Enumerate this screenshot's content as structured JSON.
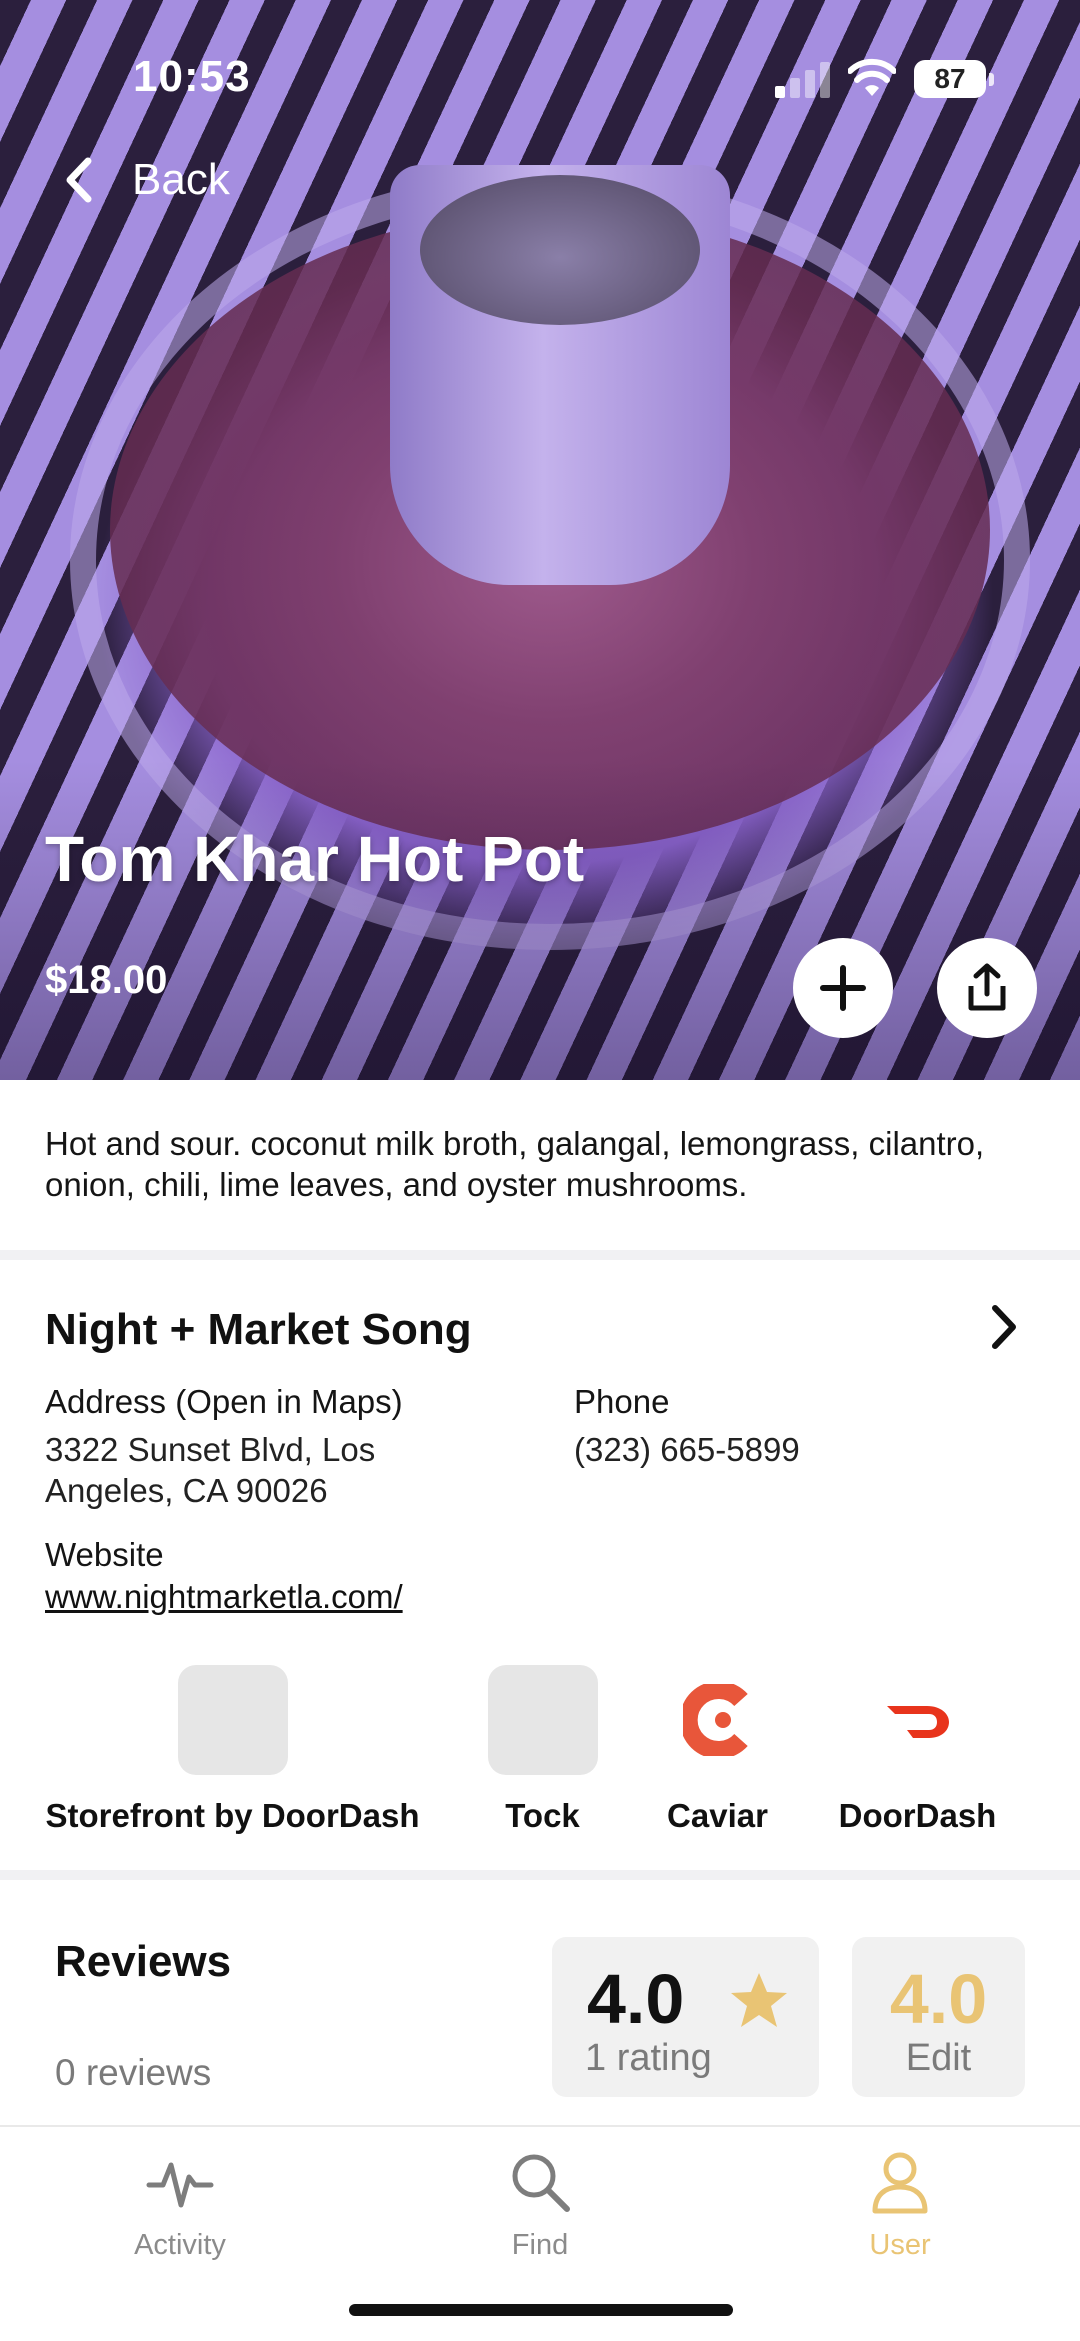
{
  "status_bar": {
    "time": "10:53",
    "battery": "87"
  },
  "nav": {
    "back_label": "Back"
  },
  "dish": {
    "name": "Tom Khar Hot Pot",
    "price": "$18.00",
    "description": "Hot and sour. coconut milk broth, galangal, lemongrass, cilantro, onion, chili, lime leaves, and oyster mushrooms."
  },
  "restaurant": {
    "name": "Night + Market Song",
    "address_label": "Address (Open in Maps)",
    "address_line1": "3322 Sunset Blvd, Los",
    "address_line2": "Angeles, CA 90026",
    "phone_label": "Phone",
    "phone": "(323) 665-5899",
    "website_label": "Website",
    "website": "www.nightmarketla.com/"
  },
  "partners": [
    {
      "name": "Storefront by DoorDash",
      "icon": "placeholder-tile"
    },
    {
      "name": "Tock",
      "icon": "placeholder-tile"
    },
    {
      "name": "Caviar",
      "icon": "caviar-logo"
    },
    {
      "name": "DoorDash",
      "icon": "doordash-logo"
    }
  ],
  "reviews": {
    "title": "Reviews",
    "count": "0 reviews",
    "rating_value": "4.0",
    "rating_sub": "1 rating",
    "user_rating": "4.0",
    "edit_label": "Edit"
  },
  "tabs": [
    {
      "label": "Activity",
      "icon": "activity-icon",
      "active": false
    },
    {
      "label": "Find",
      "icon": "search-icon",
      "active": false
    },
    {
      "label": "User",
      "icon": "user-icon",
      "active": true
    }
  ],
  "colors": {
    "accent": "#e9c474",
    "caviar": "#e8563a",
    "doordash": "#e8341c",
    "muted": "#7a7a7a"
  }
}
